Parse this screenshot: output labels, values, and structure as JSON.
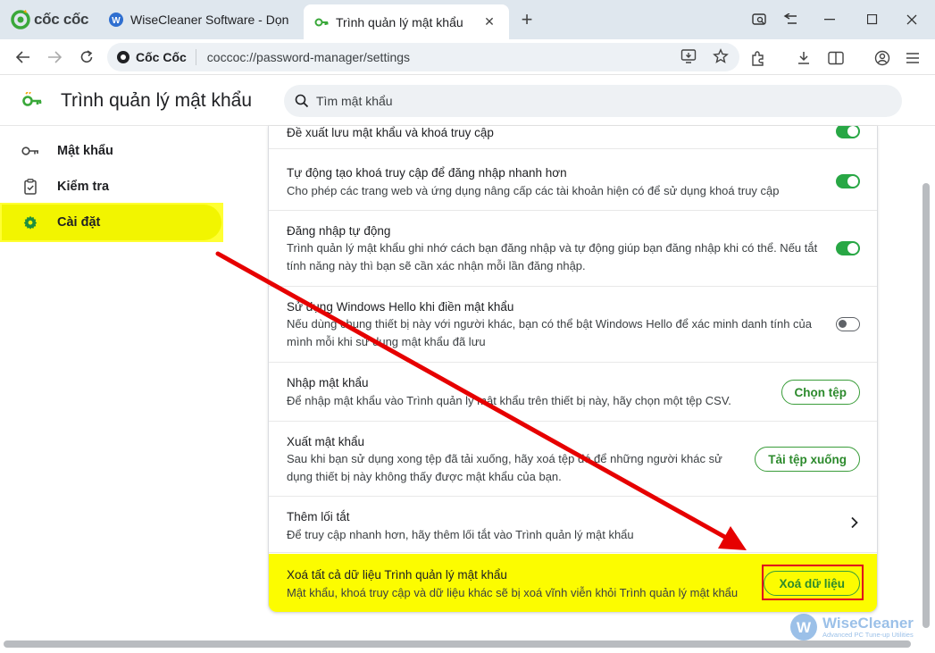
{
  "browser": {
    "brand": "cốc cốc",
    "tabs": [
      {
        "title": "WiseCleaner Software - Dọn dẹp"
      },
      {
        "title": "Trình quản lý mật khẩu"
      }
    ],
    "site_chip": "Cốc Cốc",
    "url": "coccoc://password-manager/settings"
  },
  "page": {
    "title": "Trình quản lý mật khẩu",
    "search_placeholder": "Tìm mật khẩu"
  },
  "sidebar": {
    "items": [
      {
        "label": "Mật khẩu",
        "icon": "key-icon"
      },
      {
        "label": "Kiểm tra",
        "icon": "clipboard-check-icon"
      },
      {
        "label": "Cài đặt",
        "icon": "gear-icon",
        "selected": true
      }
    ]
  },
  "settings": {
    "offer_save": {
      "title": "Đề xuất lưu mật khẩu và khoá truy cập",
      "enabled": true
    },
    "passkeys": {
      "title": "Tự động tạo khoá truy cập để đăng nhập nhanh hơn",
      "desc": "Cho phép các trang web và ứng dụng nâng cấp các tài khoản hiện có để sử dụng khoá truy cập",
      "enabled": true
    },
    "auto_signin": {
      "title": "Đăng nhập tự động",
      "desc": "Trình quản lý mật khẩu ghi nhớ cách bạn đăng nhập và tự động giúp bạn đăng nhập khi có thể. Nếu tắt tính năng này thì bạn sẽ cần xác nhận mỗi lần đăng nhập.",
      "enabled": true
    },
    "windows_hello": {
      "title": "Sử dụng Windows Hello khi điền mật khẩu",
      "desc": "Nếu dùng chung thiết bị này với người khác, bạn có thể bật Windows Hello để xác minh danh tính của mình mỗi khi sử dụng mật khẩu đã lưu",
      "enabled": false
    },
    "import": {
      "title": "Nhập mật khẩu",
      "desc": "Để nhập mật khẩu vào Trình quản lý mật khẩu trên thiết bị này, hãy chọn một tệp CSV.",
      "button": "Chọn tệp"
    },
    "export": {
      "title": "Xuất mật khẩu",
      "desc": "Sau khi bạn sử dụng xong tệp đã tải xuống, hãy xoá tệp đó để những người khác sử dụng thiết bị này không thấy được mật khẩu của bạn.",
      "button": "Tải tệp xuống"
    },
    "shortcut": {
      "title": "Thêm lối tắt",
      "desc": "Để truy cập nhanh hơn, hãy thêm lối tắt vào Trình quản lý mật khẩu"
    },
    "delete_all": {
      "title": "Xoá tất cả dữ liệu Trình quản lý mật khẩu",
      "desc": "Mật khẩu, khoá truy cập và dữ liệu khác sẽ bị xoá vĩnh viễn khỏi Trình quản lý mật khẩu",
      "button": "Xoá dữ liệu"
    }
  },
  "annotation": {
    "arrow_color": "#e60000",
    "highlight_color": "#ffff00",
    "box_color": "#e0001b"
  },
  "watermark": {
    "title": "WiseCleaner",
    "subtitle": "Advanced PC Tune-up Utilities"
  },
  "colors": {
    "accent_green": "#28a745"
  }
}
